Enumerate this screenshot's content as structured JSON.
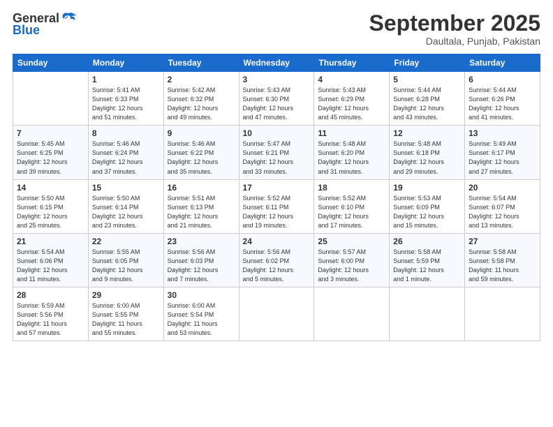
{
  "header": {
    "logo_general": "General",
    "logo_blue": "Blue",
    "month": "September 2025",
    "location": "Daultala, Punjab, Pakistan"
  },
  "weekdays": [
    "Sunday",
    "Monday",
    "Tuesday",
    "Wednesday",
    "Thursday",
    "Friday",
    "Saturday"
  ],
  "weeks": [
    [
      {
        "day": "",
        "info": ""
      },
      {
        "day": "1",
        "info": "Sunrise: 5:41 AM\nSunset: 6:33 PM\nDaylight: 12 hours\nand 51 minutes."
      },
      {
        "day": "2",
        "info": "Sunrise: 5:42 AM\nSunset: 6:32 PM\nDaylight: 12 hours\nand 49 minutes."
      },
      {
        "day": "3",
        "info": "Sunrise: 5:43 AM\nSunset: 6:30 PM\nDaylight: 12 hours\nand 47 minutes."
      },
      {
        "day": "4",
        "info": "Sunrise: 5:43 AM\nSunset: 6:29 PM\nDaylight: 12 hours\nand 45 minutes."
      },
      {
        "day": "5",
        "info": "Sunrise: 5:44 AM\nSunset: 6:28 PM\nDaylight: 12 hours\nand 43 minutes."
      },
      {
        "day": "6",
        "info": "Sunrise: 5:44 AM\nSunset: 6:26 PM\nDaylight: 12 hours\nand 41 minutes."
      }
    ],
    [
      {
        "day": "7",
        "info": "Sunrise: 5:45 AM\nSunset: 6:25 PM\nDaylight: 12 hours\nand 39 minutes."
      },
      {
        "day": "8",
        "info": "Sunrise: 5:46 AM\nSunset: 6:24 PM\nDaylight: 12 hours\nand 37 minutes."
      },
      {
        "day": "9",
        "info": "Sunrise: 5:46 AM\nSunset: 6:22 PM\nDaylight: 12 hours\nand 35 minutes."
      },
      {
        "day": "10",
        "info": "Sunrise: 5:47 AM\nSunset: 6:21 PM\nDaylight: 12 hours\nand 33 minutes."
      },
      {
        "day": "11",
        "info": "Sunrise: 5:48 AM\nSunset: 6:20 PM\nDaylight: 12 hours\nand 31 minutes."
      },
      {
        "day": "12",
        "info": "Sunrise: 5:48 AM\nSunset: 6:18 PM\nDaylight: 12 hours\nand 29 minutes."
      },
      {
        "day": "13",
        "info": "Sunrise: 5:49 AM\nSunset: 6:17 PM\nDaylight: 12 hours\nand 27 minutes."
      }
    ],
    [
      {
        "day": "14",
        "info": "Sunrise: 5:50 AM\nSunset: 6:15 PM\nDaylight: 12 hours\nand 25 minutes."
      },
      {
        "day": "15",
        "info": "Sunrise: 5:50 AM\nSunset: 6:14 PM\nDaylight: 12 hours\nand 23 minutes."
      },
      {
        "day": "16",
        "info": "Sunrise: 5:51 AM\nSunset: 6:13 PM\nDaylight: 12 hours\nand 21 minutes."
      },
      {
        "day": "17",
        "info": "Sunrise: 5:52 AM\nSunset: 6:11 PM\nDaylight: 12 hours\nand 19 minutes."
      },
      {
        "day": "18",
        "info": "Sunrise: 5:52 AM\nSunset: 6:10 PM\nDaylight: 12 hours\nand 17 minutes."
      },
      {
        "day": "19",
        "info": "Sunrise: 5:53 AM\nSunset: 6:09 PM\nDaylight: 12 hours\nand 15 minutes."
      },
      {
        "day": "20",
        "info": "Sunrise: 5:54 AM\nSunset: 6:07 PM\nDaylight: 12 hours\nand 13 minutes."
      }
    ],
    [
      {
        "day": "21",
        "info": "Sunrise: 5:54 AM\nSunset: 6:06 PM\nDaylight: 12 hours\nand 11 minutes."
      },
      {
        "day": "22",
        "info": "Sunrise: 5:55 AM\nSunset: 6:05 PM\nDaylight: 12 hours\nand 9 minutes."
      },
      {
        "day": "23",
        "info": "Sunrise: 5:56 AM\nSunset: 6:03 PM\nDaylight: 12 hours\nand 7 minutes."
      },
      {
        "day": "24",
        "info": "Sunrise: 5:56 AM\nSunset: 6:02 PM\nDaylight: 12 hours\nand 5 minutes."
      },
      {
        "day": "25",
        "info": "Sunrise: 5:57 AM\nSunset: 6:00 PM\nDaylight: 12 hours\nand 3 minutes."
      },
      {
        "day": "26",
        "info": "Sunrise: 5:58 AM\nSunset: 5:59 PM\nDaylight: 12 hours\nand 1 minute."
      },
      {
        "day": "27",
        "info": "Sunrise: 5:58 AM\nSunset: 5:58 PM\nDaylight: 11 hours\nand 59 minutes."
      }
    ],
    [
      {
        "day": "28",
        "info": "Sunrise: 5:59 AM\nSunset: 5:56 PM\nDaylight: 11 hours\nand 57 minutes."
      },
      {
        "day": "29",
        "info": "Sunrise: 6:00 AM\nSunset: 5:55 PM\nDaylight: 11 hours\nand 55 minutes."
      },
      {
        "day": "30",
        "info": "Sunrise: 6:00 AM\nSunset: 5:54 PM\nDaylight: 11 hours\nand 53 minutes."
      },
      {
        "day": "",
        "info": ""
      },
      {
        "day": "",
        "info": ""
      },
      {
        "day": "",
        "info": ""
      },
      {
        "day": "",
        "info": ""
      }
    ]
  ]
}
